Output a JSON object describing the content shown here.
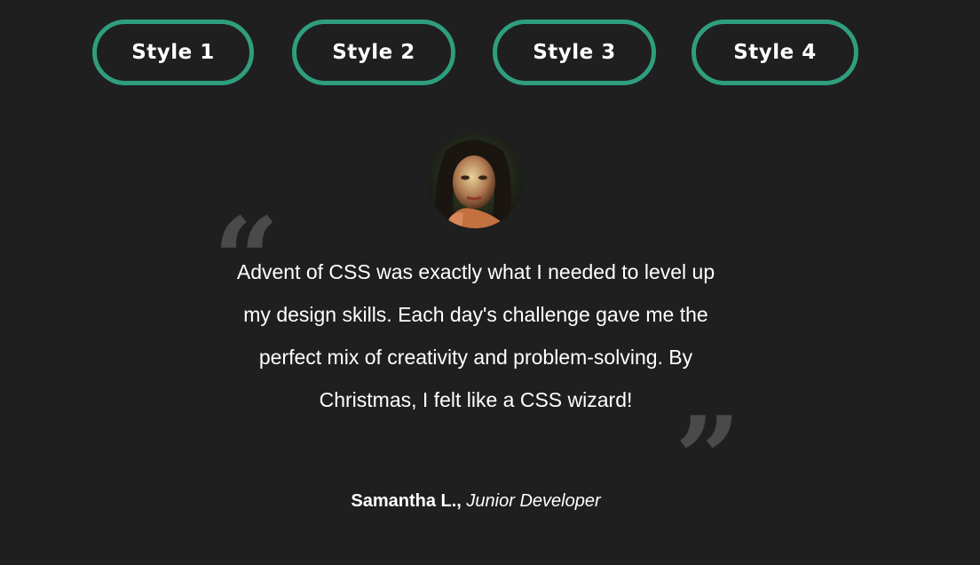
{
  "tabs": [
    {
      "label": "Style 1"
    },
    {
      "label": "Style 2"
    },
    {
      "label": "Style 3"
    },
    {
      "label": "Style 4"
    }
  ],
  "testimonial": {
    "quote": "Advent of CSS was exactly what I needed to level up my design skills. Each day's challenge gave me the perfect mix of creativity and problem-solving. By Christmas, I felt like a CSS wizard!",
    "open_mark": "“",
    "close_mark": "”",
    "author_name": "Samantha L.,",
    "author_role": "Junior Developer"
  },
  "colors": {
    "background": "#1f1f1f",
    "accent": "#2f9e7e",
    "text": "#ffffff",
    "quote_mark": "#4a4a4a"
  }
}
